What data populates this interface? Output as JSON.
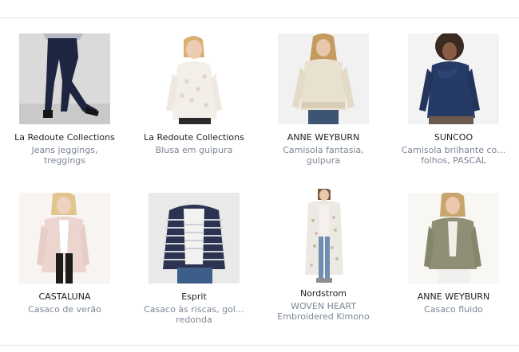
{
  "products": [
    {
      "brand": "La Redoute Collections",
      "name_line1": "Jeans jeggings,",
      "name_line2": "treggings",
      "image": "jeggings-photo"
    },
    {
      "brand": "La Redoute Collections",
      "name_line1": "Blusa em guipura",
      "name_line2": "",
      "image": "lace-blouse-photo"
    },
    {
      "brand": "ANNE WEYBURN",
      "name_line1": "Camisola fantasia,",
      "name_line2": "guipura",
      "image": "knit-sweater-photo"
    },
    {
      "brand": "SUNCOO",
      "name_line1": "Camisola brilhante co…",
      "name_line2": "folhos, PASCAL",
      "image": "ruffle-top-photo"
    },
    {
      "brand": "CASTALUNA",
      "name_line1": "Casaco de verão",
      "name_line2": "",
      "image": "pink-coat-photo"
    },
    {
      "brand": "Esprit",
      "name_line1": "Casaco às riscas, gol…",
      "name_line2": "redonda",
      "image": "striped-jacket-photo"
    },
    {
      "brand": "Nordstrom",
      "name_line1": "WOVEN HEART",
      "name_line2": "Embroidered Kimono",
      "image": "kimono-photo"
    },
    {
      "brand": "ANNE WEYBURN",
      "name_line1": "Casaco fluido",
      "name_line2": "",
      "image": "khaki-jacket-photo"
    }
  ]
}
